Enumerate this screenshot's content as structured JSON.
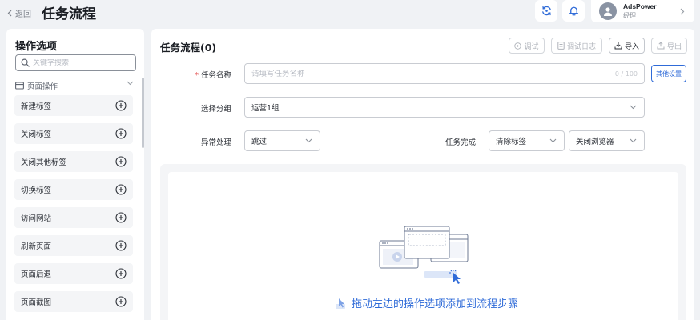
{
  "header": {
    "back_label": "返回",
    "title": "任务流程",
    "user": {
      "name": "AdsPower",
      "role": "经理"
    }
  },
  "sidebar": {
    "heading": "操作选项",
    "search_placeholder": "关键字搜索",
    "group_label": "页面操作",
    "items": [
      {
        "label": "新建标签"
      },
      {
        "label": "关闭标签"
      },
      {
        "label": "关闭其他标签"
      },
      {
        "label": "切换标签"
      },
      {
        "label": "访问网站"
      },
      {
        "label": "刷新页面"
      },
      {
        "label": "页面后退"
      },
      {
        "label": "页面截图"
      }
    ]
  },
  "main": {
    "title": "任务流程(0)",
    "toolbar": {
      "debug": "调试",
      "debug_log": "调试日志",
      "import": "导入",
      "export": "导出"
    },
    "form": {
      "task_name_label": "任务名称",
      "task_name_placeholder": "请填写任务名称",
      "task_name_count": "0 / 100",
      "other_settings": "其他设置",
      "group_label": "选择分组",
      "group_value": "运营1组",
      "exception_label": "异常处理",
      "exception_value": "跳过",
      "complete_label": "任务完成",
      "complete_value_1": "清除标签",
      "complete_value_2": "关闭浏览器"
    },
    "canvas_hint": "拖动左边的操作选项添加到流程步骤"
  },
  "colors": {
    "accent": "#2f6bd8",
    "page_bg": "#f0f2f5",
    "required": "#e34d4d"
  }
}
